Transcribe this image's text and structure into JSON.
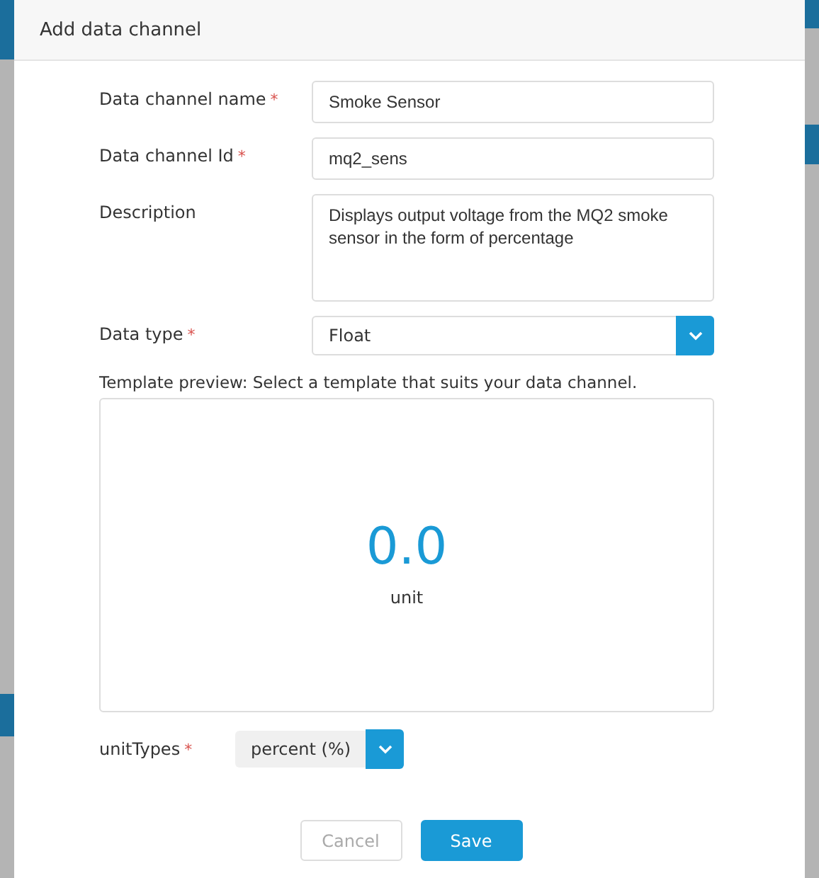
{
  "dialog": {
    "title": "Add data channel"
  },
  "fields": [
    {
      "kind": "text",
      "label": "Data channel name",
      "required_mark": "*",
      "value": "Smoke Sensor"
    },
    {
      "kind": "text",
      "label": "Data channel Id",
      "required_mark": "*",
      "value": "mq2_sens"
    },
    {
      "kind": "textarea",
      "label": "Description",
      "value": "Displays output voltage from the MQ2 smoke sensor in the form of percentage"
    },
    {
      "kind": "select",
      "label": "Data type",
      "required_mark": "*",
      "value": "Float"
    }
  ],
  "template_preview": {
    "label": "Template preview: Select a template that suits your data channel.",
    "value": "0.0",
    "unit": "unit"
  },
  "unit_types": {
    "label": "unitTypes",
    "required_mark": "*",
    "value": "percent (%)"
  },
  "buttons": [
    {
      "kind": "secondary",
      "label": "Cancel",
      "disabled": true
    },
    {
      "kind": "primary",
      "label": "Save",
      "disabled": false
    }
  ]
}
